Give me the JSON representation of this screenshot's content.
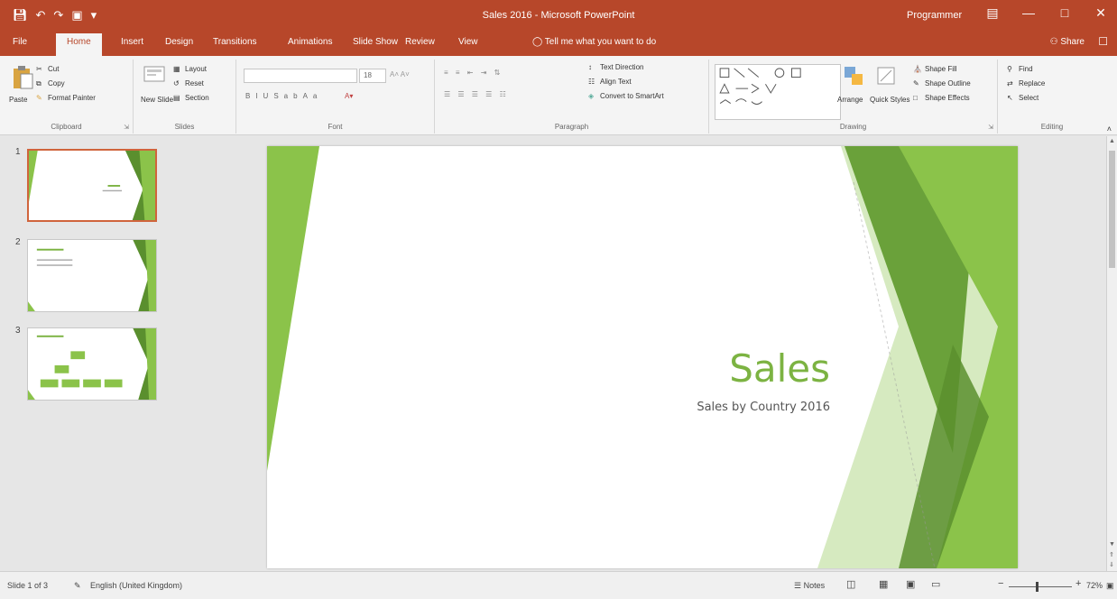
{
  "titlebar": {
    "doc_title": "Sales 2016 - Microsoft PowerPoint",
    "user": "Programmer",
    "qat_icons": [
      "save-icon",
      "undo-icon",
      "redo-icon",
      "start-from-beginning-icon",
      "customize-qat-icon"
    ],
    "win_controls": [
      "ribbon-display-options-icon",
      "minimize-icon",
      "maximize-icon",
      "close-icon"
    ]
  },
  "tabs": {
    "items": [
      "File",
      "Home",
      "Insert",
      "Design",
      "Transitions",
      "Animations",
      "Slide Show",
      "Review",
      "View"
    ],
    "active": "Home",
    "tell_me": "Tell me what you want to do",
    "share": "Share"
  },
  "ribbon": {
    "clipboard": {
      "label": "Clipboard",
      "paste": "Paste",
      "cut": "Cut",
      "copy": "Copy",
      "format_painter": "Format Painter"
    },
    "slides": {
      "label": "Slides",
      "new_slide": "New Slide",
      "layout": "Layout",
      "reset": "Reset",
      "section": "Section"
    },
    "font": {
      "label": "Font",
      "font_name": "",
      "font_size": "18"
    },
    "paragraph": {
      "label": "Paragraph",
      "text_direction": "Text Direction",
      "align_text": "Align Text",
      "convert_smartart": "Convert to SmartArt"
    },
    "drawing": {
      "label": "Drawing",
      "arrange": "Arrange",
      "quick_styles": "Quick Styles",
      "shape_fill": "Shape Fill",
      "shape_outline": "Shape Outline",
      "shape_effects": "Shape Effects"
    },
    "editing": {
      "label": "Editing",
      "find": "Find",
      "replace": "Replace",
      "select": "Select"
    }
  },
  "thumbnails": [
    {
      "number": "1",
      "selected": true
    },
    {
      "number": "2",
      "selected": false
    },
    {
      "number": "3",
      "selected": false
    }
  ],
  "slide": {
    "title": "Sales",
    "subtitle": "Sales by Country 2016",
    "accent_color": "#7cb342"
  },
  "statusbar": {
    "slide_info": "Slide 1 of 3",
    "language": "English (United Kingdom)",
    "notes": "Notes",
    "zoom": "72%",
    "zoom_level": 0.44
  },
  "colors": {
    "brand": "#b7472a",
    "ribbon_bg": "#f4f4f4",
    "pane_bg": "#e6e6e6",
    "green_light": "#8bc34a",
    "green_dark": "#5a8f2e"
  }
}
